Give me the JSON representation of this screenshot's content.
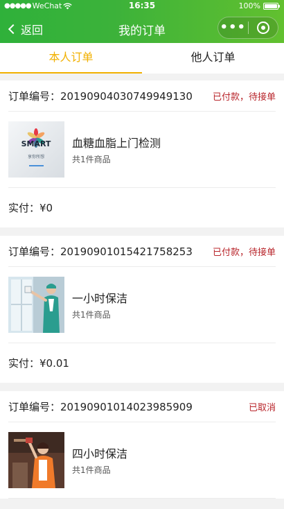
{
  "status_bar": {
    "carrier": "WeChat",
    "time": "16:35",
    "battery": "100%"
  },
  "nav": {
    "back_label": "返回",
    "title": "我的订单"
  },
  "tabs": [
    {
      "label": "本人订单",
      "active": true
    },
    {
      "label": "他人订单",
      "active": false
    }
  ],
  "orders": [
    {
      "no_label": "订单编号：",
      "no": "20190904030749949130",
      "status": "已付款，待接单",
      "item_name": "血糖血脂上门检测",
      "item_count": "共1件商品",
      "image_icon": "smart-logo-image",
      "image_text": "SMART",
      "image_subtext": "享你所想",
      "pay_label": "实付：",
      "pay_amount": "¥0"
    },
    {
      "no_label": "订单编号：",
      "no": "20190901015421758253",
      "status": "已付款，待接单",
      "item_name": "一小时保洁",
      "item_count": "共1件商品",
      "image_icon": "cleaning-window-photo",
      "pay_label": "实付：",
      "pay_amount": "¥0.01"
    },
    {
      "no_label": "订单编号：",
      "no": "20190901014023985909",
      "status": "已取消",
      "item_name": "四小时保洁",
      "item_count": "共1件商品",
      "image_icon": "cleaning-kitchen-photo"
    }
  ],
  "colors": {
    "brand_green": "#3cb23a",
    "tab_active": "#f1b000",
    "status_red": "#b8242a"
  }
}
